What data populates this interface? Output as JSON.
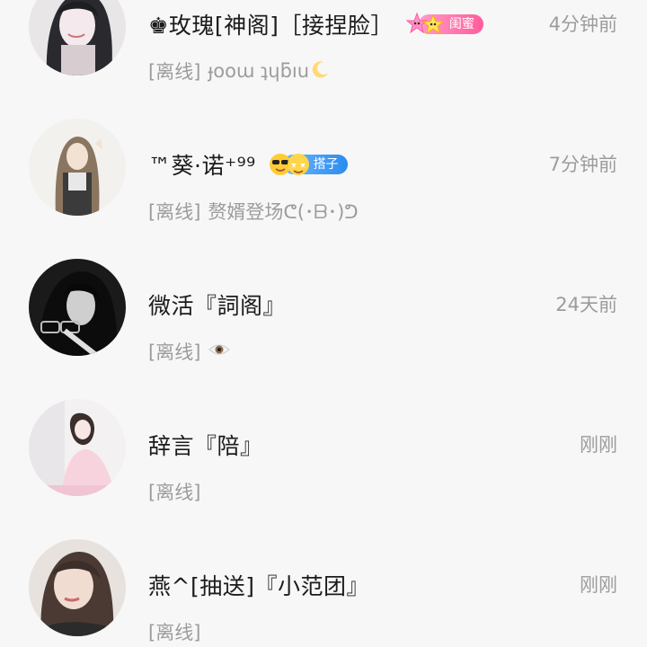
{
  "contacts": [
    {
      "name": "♚玫瑰[神阁]［接捏脸］",
      "badge": {
        "label": "闺蜜",
        "style": "pink",
        "emoji_icon": "sparkle-stars-icon"
      },
      "time": "4分钟前",
      "status": "[离线]",
      "signature": "ɟooɯ ʇɥƃıu",
      "signature_icon": "crescent-moon-icon"
    },
    {
      "name": "™葵·诺⁺⁹⁹",
      "badge": {
        "label": "搭子",
        "style": "blue",
        "emoji_icon": "sunglasses-emoji-icon"
      },
      "time": "7分钟前",
      "status": "[离线]",
      "signature": "赘婿登场ᕦ(･ᗷ･)ᕤ"
    },
    {
      "name": "微活『詞阁』",
      "time": "24天前",
      "status": "[离线]",
      "signature_icon": "eye-icon"
    },
    {
      "name": "辞言『陪』",
      "time": "刚刚",
      "status": "[离线]"
    },
    {
      "name": "燕^[抽送]『小范团』",
      "time": "刚刚",
      "status": "[离线]"
    }
  ],
  "colors": {
    "background": "#f7f7f7",
    "name_text": "#1b1b1b",
    "meta_text": "#9c9c9c",
    "badge_pink": "#ff6fa8",
    "badge_blue": "#2a8cf0"
  }
}
